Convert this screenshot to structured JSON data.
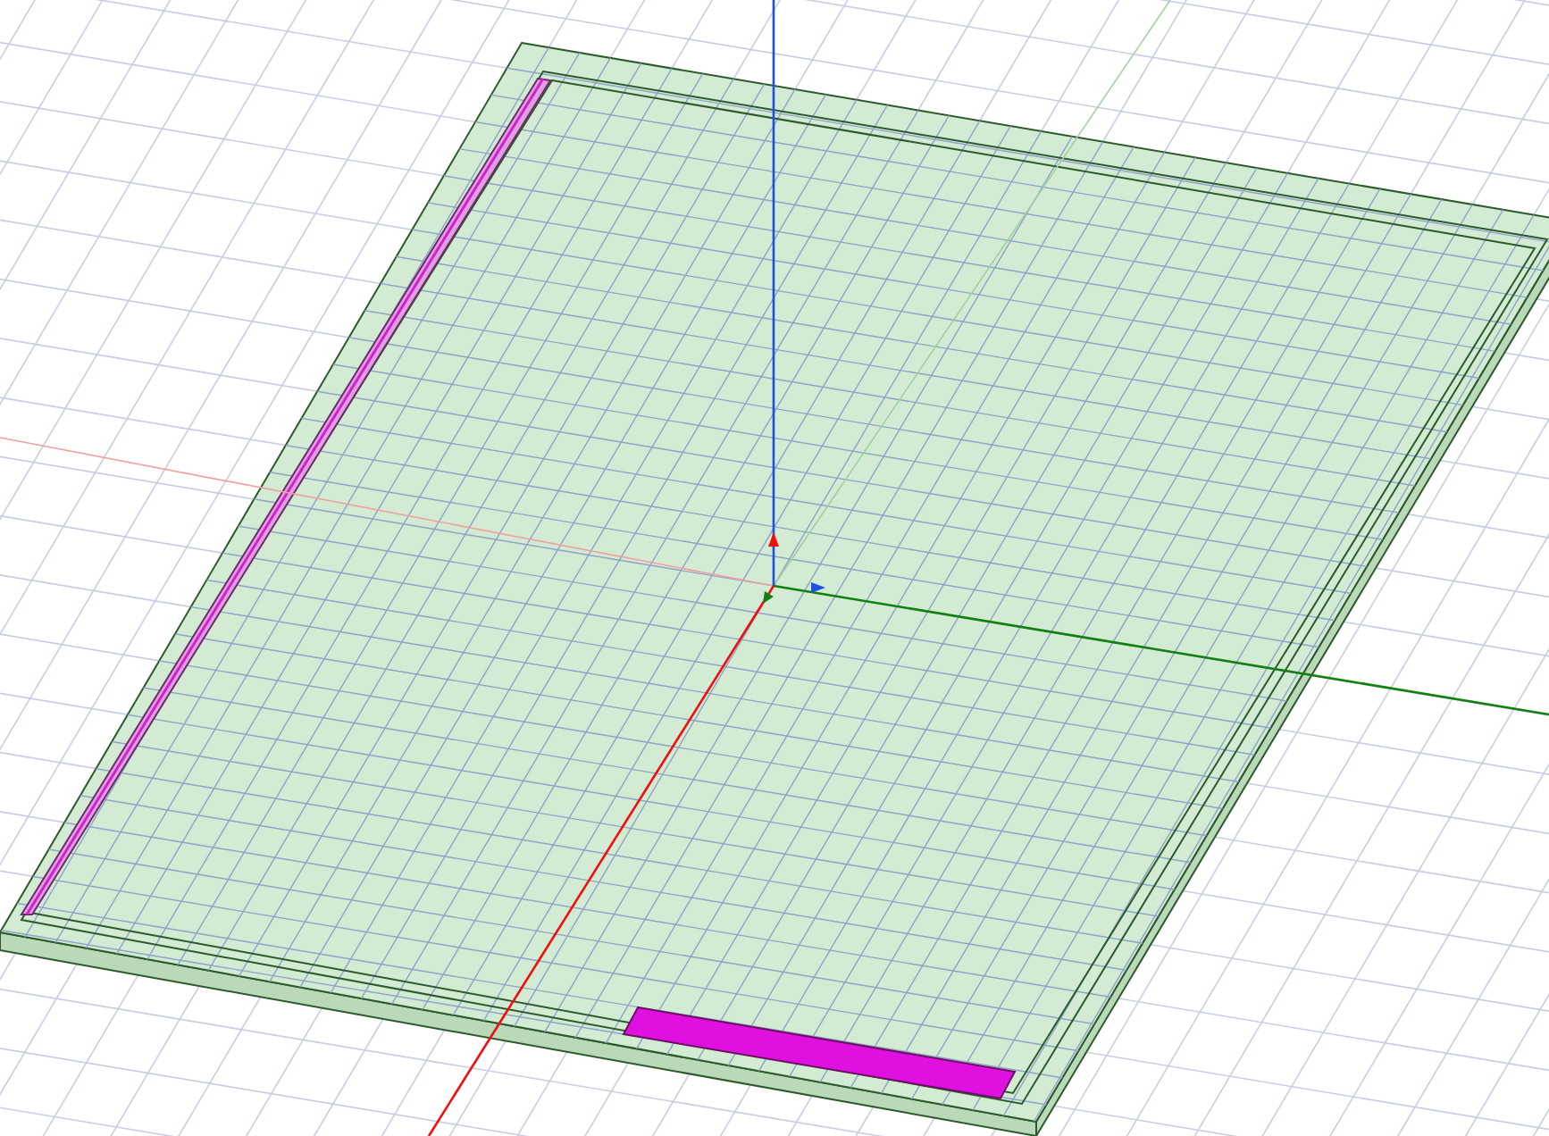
{
  "viewport": {
    "kind": "model",
    "show_axes": true
  }
}
